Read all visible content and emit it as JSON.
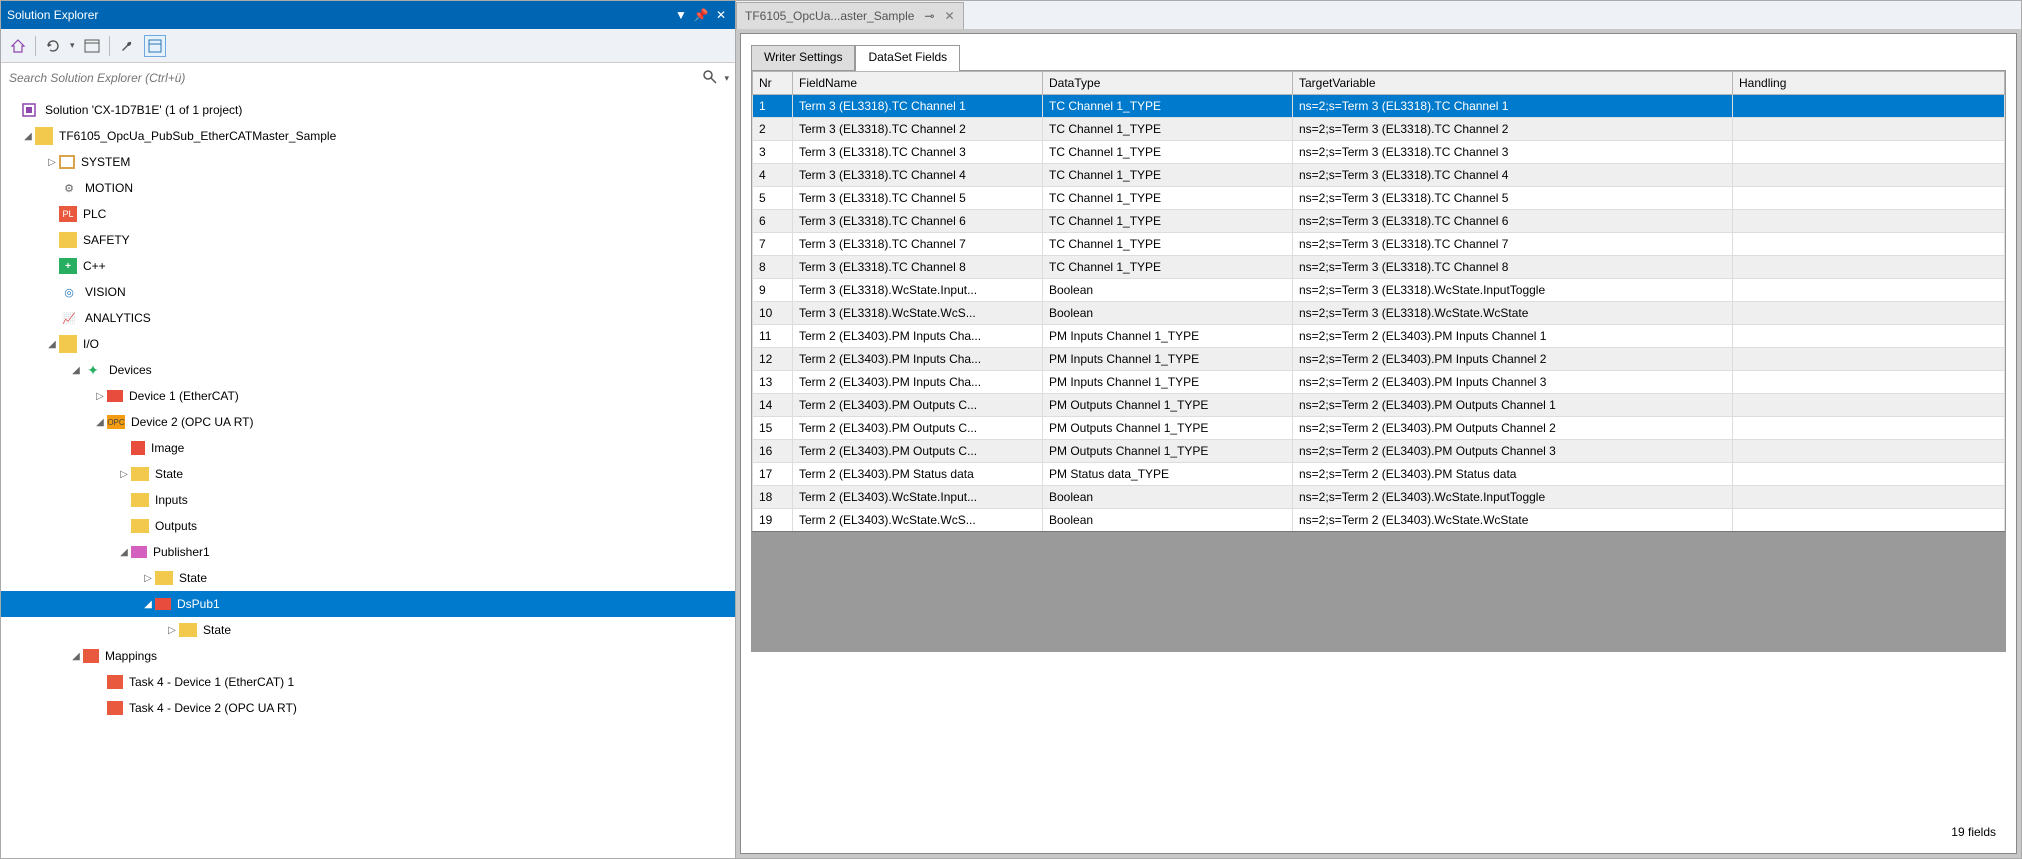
{
  "solution_explorer": {
    "title": "Solution Explorer",
    "search_placeholder": "Search Solution Explorer (Ctrl+ü)",
    "solution_label": "Solution 'CX-1D7B1E' (1 of 1 project)",
    "project_label": "TF6105_OpcUa_PubSub_EtherCATMaster_Sample",
    "nodes": {
      "system": "SYSTEM",
      "motion": "MOTION",
      "plc": "PLC",
      "safety": "SAFETY",
      "cpp": "C++",
      "vision": "VISION",
      "analytics": "ANALYTICS",
      "io": "I/O",
      "devices": "Devices",
      "device1": "Device 1 (EtherCAT)",
      "device2": "Device 2 (OPC UA RT)",
      "image": "Image",
      "state": "State",
      "inputs": "Inputs",
      "outputs": "Outputs",
      "publisher1": "Publisher1",
      "dspub1": "DsPub1",
      "mappings": "Mappings",
      "task4a": "Task 4 - Device 1 (EtherCAT) 1",
      "task4b": "Task 4 - Device 2 (OPC UA RT)"
    }
  },
  "doc_tab": {
    "title": "TF6105_OpcUa...aster_Sample",
    "pin": "⊷"
  },
  "subtabs": {
    "writer": "Writer Settings",
    "dataset": "DataSet Fields"
  },
  "grid": {
    "headers": {
      "nr": "Nr",
      "fieldname": "FieldName",
      "datatype": "DataType",
      "targetvar": "TargetVariable",
      "handling": "Handling"
    },
    "rows": [
      {
        "nr": "1",
        "fn": "Term 3 (EL3318).TC Channel 1",
        "dt": "TC Channel 1_TYPE",
        "tv": "ns=2;s=Term 3 (EL3318).TC Channel 1",
        "h": ""
      },
      {
        "nr": "2",
        "fn": "Term 3 (EL3318).TC Channel 2",
        "dt": "TC Channel 1_TYPE",
        "tv": "ns=2;s=Term 3 (EL3318).TC Channel 2",
        "h": ""
      },
      {
        "nr": "3",
        "fn": "Term 3 (EL3318).TC Channel 3",
        "dt": "TC Channel 1_TYPE",
        "tv": "ns=2;s=Term 3 (EL3318).TC Channel 3",
        "h": ""
      },
      {
        "nr": "4",
        "fn": "Term 3 (EL3318).TC Channel 4",
        "dt": "TC Channel 1_TYPE",
        "tv": "ns=2;s=Term 3 (EL3318).TC Channel 4",
        "h": ""
      },
      {
        "nr": "5",
        "fn": "Term 3 (EL3318).TC Channel 5",
        "dt": "TC Channel 1_TYPE",
        "tv": "ns=2;s=Term 3 (EL3318).TC Channel 5",
        "h": ""
      },
      {
        "nr": "6",
        "fn": "Term 3 (EL3318).TC Channel 6",
        "dt": "TC Channel 1_TYPE",
        "tv": "ns=2;s=Term 3 (EL3318).TC Channel 6",
        "h": ""
      },
      {
        "nr": "7",
        "fn": "Term 3 (EL3318).TC Channel 7",
        "dt": "TC Channel 1_TYPE",
        "tv": "ns=2;s=Term 3 (EL3318).TC Channel 7",
        "h": ""
      },
      {
        "nr": "8",
        "fn": "Term 3 (EL3318).TC Channel 8",
        "dt": "TC Channel 1_TYPE",
        "tv": "ns=2;s=Term 3 (EL3318).TC Channel 8",
        "h": ""
      },
      {
        "nr": "9",
        "fn": "Term 3 (EL3318).WcState.Input...",
        "dt": "Boolean",
        "tv": "ns=2;s=Term 3 (EL3318).WcState.InputToggle",
        "h": ""
      },
      {
        "nr": "10",
        "fn": "Term 3 (EL3318).WcState.WcS...",
        "dt": "Boolean",
        "tv": "ns=2;s=Term 3 (EL3318).WcState.WcState",
        "h": ""
      },
      {
        "nr": "11",
        "fn": "Term 2 (EL3403).PM Inputs Cha...",
        "dt": "PM Inputs Channel 1_TYPE",
        "tv": "ns=2;s=Term 2 (EL3403).PM Inputs Channel 1",
        "h": ""
      },
      {
        "nr": "12",
        "fn": "Term 2 (EL3403).PM Inputs Cha...",
        "dt": "PM Inputs Channel 1_TYPE",
        "tv": "ns=2;s=Term 2 (EL3403).PM Inputs Channel 2",
        "h": ""
      },
      {
        "nr": "13",
        "fn": "Term 2 (EL3403).PM Inputs Cha...",
        "dt": "PM Inputs Channel 1_TYPE",
        "tv": "ns=2;s=Term 2 (EL3403).PM Inputs Channel 3",
        "h": ""
      },
      {
        "nr": "14",
        "fn": "Term 2 (EL3403).PM Outputs C...",
        "dt": "PM Outputs Channel 1_TYPE",
        "tv": "ns=2;s=Term 2 (EL3403).PM Outputs Channel 1",
        "h": ""
      },
      {
        "nr": "15",
        "fn": "Term 2 (EL3403).PM Outputs C...",
        "dt": "PM Outputs Channel 1_TYPE",
        "tv": "ns=2;s=Term 2 (EL3403).PM Outputs Channel 2",
        "h": ""
      },
      {
        "nr": "16",
        "fn": "Term 2 (EL3403).PM Outputs C...",
        "dt": "PM Outputs Channel 1_TYPE",
        "tv": "ns=2;s=Term 2 (EL3403).PM Outputs Channel 3",
        "h": ""
      },
      {
        "nr": "17",
        "fn": "Term 2 (EL3403).PM Status data",
        "dt": "PM Status data_TYPE",
        "tv": "ns=2;s=Term 2 (EL3403).PM Status data",
        "h": ""
      },
      {
        "nr": "18",
        "fn": "Term 2 (EL3403).WcState.Input...",
        "dt": "Boolean",
        "tv": "ns=2;s=Term 2 (EL3403).WcState.InputToggle",
        "h": ""
      },
      {
        "nr": "19",
        "fn": "Term 2 (EL3403).WcState.WcS...",
        "dt": "Boolean",
        "tv": "ns=2;s=Term 2 (EL3403).WcState.WcState",
        "h": ""
      }
    ],
    "status": "19 fields"
  }
}
